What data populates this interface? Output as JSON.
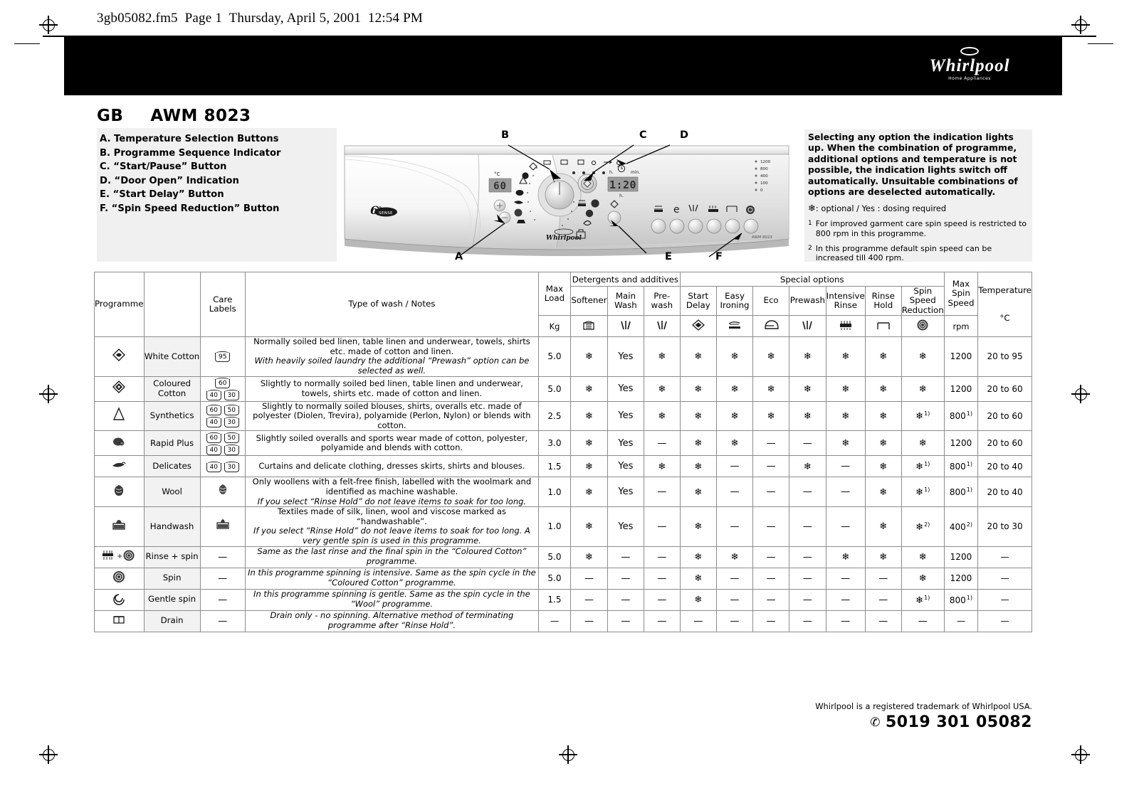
{
  "page_header": "3gb05082.fm5  Page 1  Thursday, April 5, 2001  12:54 PM",
  "brand": {
    "name": "Whirlpool",
    "tagline": "Home Appliances"
  },
  "title": {
    "country_code": "GB",
    "model": "AWM 8023"
  },
  "legend": [
    "A. Temperature Selection Buttons",
    "B. Programme Sequence Indicator",
    "C. “Start/Pause” Button",
    "D. “Door Open” Indication",
    "E. “Start Delay” Button",
    "F. “Spin Speed Reduction” Button"
  ],
  "callouts": [
    "A",
    "B",
    "C",
    "D",
    "E",
    "F"
  ],
  "panel": {
    "temp_display": "60",
    "temp_unit": "°C",
    "time_display": "1:20",
    "time_labels": {
      "left": "h.",
      "right": "min.",
      "bottom": "h."
    },
    "sixth_sense": "6th",
    "sixth_sense_sub": "SENSE",
    "brand_small": "Whirlpool",
    "model_small": "AWM 8023",
    "spin_levels": [
      "1200",
      "800",
      "400",
      "100",
      "0"
    ]
  },
  "notes": {
    "bold": "Selecting any option the indication lights up. When the combination of programme, additional options and temperature is not possible, the indication lights switch off automatically. Unsuitable combinations of options are deselected automatically.",
    "legend_line": ": optional / Yes : dosing required",
    "footnotes": [
      {
        "num": "1",
        "text": "For improved garment care spin speed is restricted to 800 rpm in this programme."
      },
      {
        "num": "2",
        "text": "In this programme default spin speed can be increased till 400 rpm."
      }
    ]
  },
  "table": {
    "group_headers": {
      "detergents": "Detergents and additives",
      "special": "Special options"
    },
    "columns": [
      {
        "key": "programme",
        "label": "Programme",
        "unit": ""
      },
      {
        "key": "care",
        "label": "Care Labels",
        "unit": ""
      },
      {
        "key": "notes",
        "label": "Type of wash / Notes",
        "unit": ""
      },
      {
        "key": "load",
        "label": "Max Load",
        "unit": "Kg",
        "icon": ""
      },
      {
        "key": "softener",
        "label": "Softener",
        "unit": "",
        "icon": "softener-icon"
      },
      {
        "key": "mainwash",
        "label": "Main Wash",
        "unit": "",
        "icon": "main-wash-icon"
      },
      {
        "key": "prewash_det",
        "label": "Pre-wash",
        "unit": "",
        "icon": "prewash-icon"
      },
      {
        "key": "startdelay",
        "label": "Start Delay",
        "unit": "",
        "icon": "start-delay-icon"
      },
      {
        "key": "easyironing",
        "label": "Easy Ironing",
        "unit": "",
        "icon": "iron-icon"
      },
      {
        "key": "eco",
        "label": "Eco",
        "unit": "",
        "icon": "eco-icon"
      },
      {
        "key": "prewash",
        "label": "Prewash",
        "unit": "",
        "icon": "prewash-option-icon"
      },
      {
        "key": "intensiverinse",
        "label": "Intensive Rinse",
        "unit": "",
        "icon": "intensive-rinse-icon"
      },
      {
        "key": "rinsehold",
        "label": "Rinse Hold",
        "unit": "",
        "icon": "rinse-hold-icon"
      },
      {
        "key": "spinreduction",
        "label": "Spin Speed Reduction",
        "unit": "",
        "icon": "spin-reduction-icon"
      },
      {
        "key": "maxspin",
        "label": "Max Spin Speed",
        "unit": "rpm"
      },
      {
        "key": "temperature",
        "label": "Temperature",
        "unit": "°C"
      }
    ],
    "rows": [
      {
        "icon": "white-cotton-icon",
        "programme": "White Cotton",
        "care_labels": [
          [
            "95"
          ]
        ],
        "notes_plain": "Normally soiled bed linen, table linen and underwear, towels, shirts etc. made of cotton and linen.",
        "notes_italic": "With heavily soiled laundry the additional “Prewash” option can be selected as well.",
        "load": "5.0",
        "softener": "*",
        "mainwash": "Yes",
        "prewash_det": "*",
        "startdelay": "*",
        "easyironing": "*",
        "eco": "*",
        "prewash": "*",
        "intensiverinse": "*",
        "rinsehold": "*",
        "spinreduction": "*",
        "maxspin": "1200",
        "maxspin_fn": "",
        "temperature": "20 to 95"
      },
      {
        "icon": "coloured-cotton-icon",
        "programme": "Coloured Cotton",
        "care_labels": [
          [
            "60"
          ],
          [
            "40",
            "30"
          ]
        ],
        "notes_plain": "Slightly to normally soiled bed linen, table linen and underwear, towels, shirts etc. made of cotton and linen.",
        "notes_italic": "",
        "load": "5.0",
        "softener": "*",
        "mainwash": "Yes",
        "prewash_det": "*",
        "startdelay": "*",
        "easyironing": "*",
        "eco": "*",
        "prewash": "*",
        "intensiverinse": "*",
        "rinsehold": "*",
        "spinreduction": "*",
        "maxspin": "1200",
        "maxspin_fn": "",
        "temperature": "20 to 60"
      },
      {
        "icon": "synthetics-icon",
        "programme": "Synthetics",
        "care_labels": [
          [
            "60",
            "50"
          ],
          [
            "40",
            "30"
          ]
        ],
        "notes_plain": "Slightly to normally soiled blouses, shirts, overalls etc. made of polyester (Diolen, Trevira), polyamide (Perlon, Nylon) or blends with cotton.",
        "notes_italic": "",
        "load": "2.5",
        "softener": "*",
        "mainwash": "Yes",
        "prewash_det": "*",
        "startdelay": "*",
        "easyironing": "*",
        "eco": "*",
        "prewash": "*",
        "intensiverinse": "*",
        "rinsehold": "*",
        "spinreduction": "*",
        "spinreduction_fn": "1)",
        "maxspin": "800",
        "maxspin_fn": "1)",
        "temperature": "20 to 60"
      },
      {
        "icon": "rapid-plus-icon",
        "programme": "Rapid Plus",
        "care_labels": [
          [
            "60",
            "50"
          ],
          [
            "40",
            "30"
          ]
        ],
        "notes_plain": "Slightly soiled overalls and sports wear made of cotton, polyester, polyamide and blends with cotton.",
        "notes_italic": "",
        "load": "3.0",
        "softener": "*",
        "mainwash": "Yes",
        "prewash_det": "—",
        "startdelay": "*",
        "easyironing": "*",
        "eco": "—",
        "prewash": "—",
        "intensiverinse": "*",
        "rinsehold": "*",
        "spinreduction": "*",
        "maxspin": "1200",
        "maxspin_fn": "",
        "temperature": "20 to 60"
      },
      {
        "icon": "delicates-icon",
        "programme": "Delicates",
        "care_labels": [
          [
            "40",
            "30"
          ]
        ],
        "notes_plain": "Curtains and delicate clothing, dresses skirts, shirts and blouses.",
        "notes_italic": "",
        "load": "1.5",
        "softener": "*",
        "mainwash": "Yes",
        "prewash_det": "*",
        "startdelay": "*",
        "easyironing": "—",
        "eco": "—",
        "prewash": "*",
        "intensiverinse": "—",
        "rinsehold": "*",
        "spinreduction": "*",
        "spinreduction_fn": "1)",
        "maxspin": "800",
        "maxspin_fn": "1)",
        "temperature": "20 to 40"
      },
      {
        "icon": "wool-icon",
        "programme": "Wool",
        "care_labels": [
          [
            "wool"
          ]
        ],
        "notes_plain": "Only woollens with a felt-free finish, labelled with the woolmark and identified as machine washable.",
        "notes_italic": "If you select “Rinse Hold” do not leave items to soak for too long.",
        "load": "1.0",
        "softener": "*",
        "mainwash": "Yes",
        "prewash_det": "—",
        "startdelay": "*",
        "easyironing": "—",
        "eco": "—",
        "prewash": "—",
        "intensiverinse": "—",
        "rinsehold": "*",
        "spinreduction": "*",
        "spinreduction_fn": "1)",
        "maxspin": "800",
        "maxspin_fn": "1)",
        "temperature": "20 to 40"
      },
      {
        "icon": "handwash-icon",
        "programme": "Handwash",
        "care_labels": [
          [
            "hand"
          ]
        ],
        "notes_plain": "Textiles made of silk, linen, wool and viscose marked as “handwashable”.",
        "notes_italic": "If you select “Rinse Hold” do not leave items to soak for too long. A very gentle spin is used in this programme.",
        "load": "1.0",
        "softener": "*",
        "mainwash": "Yes",
        "prewash_det": "—",
        "startdelay": "*",
        "easyironing": "—",
        "eco": "—",
        "prewash": "—",
        "intensiverinse": "—",
        "rinsehold": "*",
        "spinreduction": "*",
        "spinreduction_fn": "2)",
        "maxspin": "400",
        "maxspin_fn": "2)",
        "temperature": "20 to 30"
      },
      {
        "icon": "rinse-spin-icon",
        "programme": "Rinse + spin",
        "care_labels": [],
        "care_dash": "—",
        "notes_plain": "",
        "notes_italic": "Same as the last rinse and the final spin in the “Coloured Cotton” programme.",
        "load": "5.0",
        "softener": "*",
        "mainwash": "—",
        "prewash_det": "—",
        "startdelay": "*",
        "easyironing": "*",
        "eco": "—",
        "prewash": "—",
        "intensiverinse": "*",
        "rinsehold": "*",
        "spinreduction": "*",
        "maxspin": "1200",
        "maxspin_fn": "",
        "temperature": "—"
      },
      {
        "icon": "spin-icon",
        "programme": "Spin",
        "care_labels": [],
        "care_dash": "—",
        "notes_plain": "",
        "notes_italic": "In this programme spinning is intensive. Same as the spin cycle in the “Coloured Cotton” programme.",
        "load": "5.0",
        "softener": "—",
        "mainwash": "—",
        "prewash_det": "—",
        "startdelay": "*",
        "easyironing": "—",
        "eco": "—",
        "prewash": "—",
        "intensiverinse": "—",
        "rinsehold": "—",
        "spinreduction": "*",
        "maxspin": "1200",
        "maxspin_fn": "",
        "temperature": "—"
      },
      {
        "icon": "gentle-spin-icon",
        "programme": "Gentle spin",
        "care_labels": [],
        "care_dash": "—",
        "notes_plain": "",
        "notes_italic": "In this programme spinning is gentle. Same as the spin cycle in the “Wool” programme.",
        "load": "1.5",
        "softener": "—",
        "mainwash": "—",
        "prewash_det": "—",
        "startdelay": "*",
        "easyironing": "—",
        "eco": "—",
        "prewash": "—",
        "intensiverinse": "—",
        "rinsehold": "—",
        "spinreduction": "*",
        "spinreduction_fn": "1)",
        "maxspin": "800",
        "maxspin_fn": "1)",
        "temperature": "—"
      },
      {
        "icon": "drain-icon",
        "programme": "Drain",
        "care_labels": [],
        "care_dash": "—",
        "notes_plain": "",
        "notes_italic": "Drain only - no spinning. Alternative method of terminating programme after “Rinse Hold”.",
        "load": "—",
        "softener": "—",
        "mainwash": "—",
        "prewash_det": "—",
        "startdelay": "—",
        "easyironing": "—",
        "eco": "—",
        "prewash": "—",
        "intensiverinse": "—",
        "rinsehold": "—",
        "spinreduction": "—",
        "maxspin": "—",
        "maxspin_fn": "",
        "temperature": "—"
      }
    ]
  },
  "footer": {
    "trademark": "Whirlpool is a registered trademark of Whirlpool USA.",
    "part_number": "5019 301 05082"
  }
}
